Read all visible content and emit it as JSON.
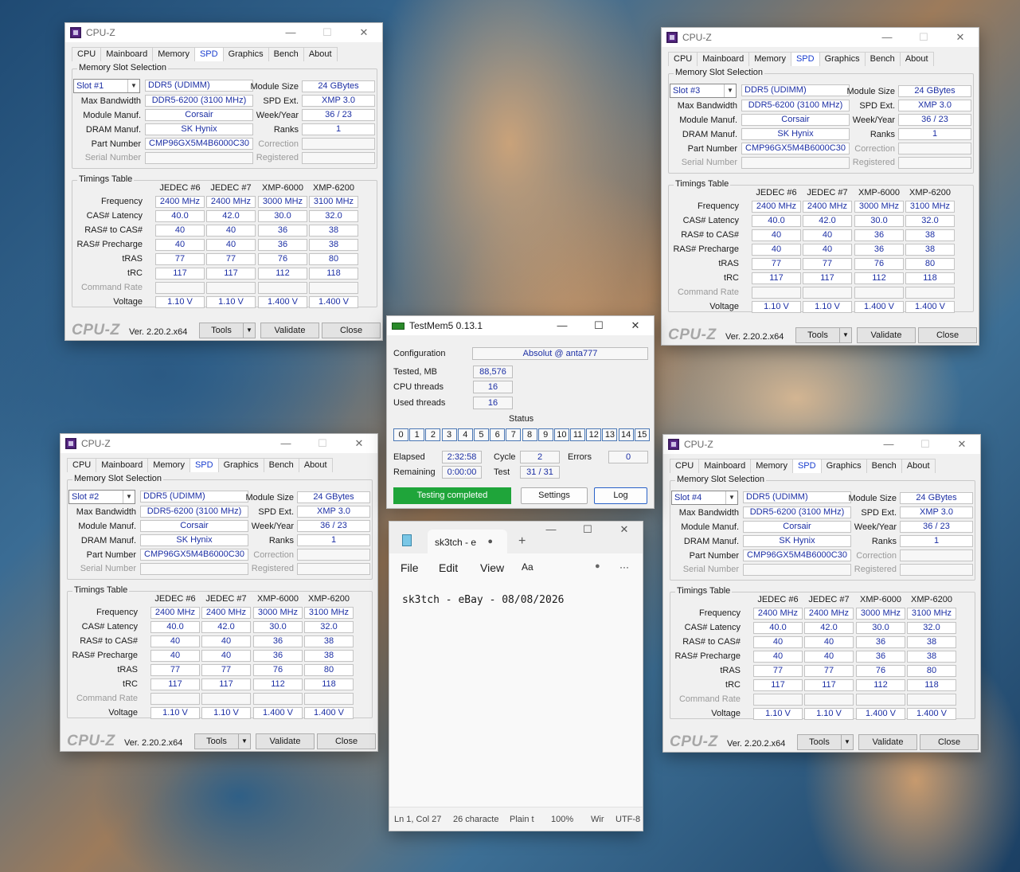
{
  "cpuz": {
    "title": "CPU-Z",
    "tabs": [
      "CPU",
      "Mainboard",
      "Memory",
      "SPD",
      "Graphics",
      "Bench",
      "About"
    ],
    "active_tab": "SPD",
    "min_icon": "—",
    "max_icon": "☐",
    "close_icon": "✕",
    "dropdown_icon": "▼",
    "group_memory": "Memory Slot Selection",
    "group_timings": "Timings Table",
    "labels": {
      "max_bandwidth": "Max Bandwidth",
      "module_manuf": "Module Manuf.",
      "dram_manuf": "DRAM Manuf.",
      "part_number": "Part Number",
      "serial_number": "Serial Number",
      "module_size": "Module Size",
      "spd_ext": "SPD Ext.",
      "week_year": "Week/Year",
      "ranks": "Ranks",
      "correction": "Correction",
      "registered": "Registered"
    },
    "values": {
      "type": "DDR5 (UDIMM)",
      "max_bandwidth": "DDR5-6200 (3100 MHz)",
      "module_manuf": "Corsair",
      "dram_manuf": "SK Hynix",
      "part_number": "CMP96GX5M4B6000C30",
      "module_size": "24 GBytes",
      "spd_ext": "XMP 3.0",
      "week_year": "36 / 23",
      "ranks": "1"
    },
    "timing_cols": [
      "JEDEC #6",
      "JEDEC #7",
      "XMP-6000",
      "XMP-6200"
    ],
    "timing_rows": [
      {
        "label": "Frequency",
        "vals": [
          "2400 MHz",
          "2400 MHz",
          "3000 MHz",
          "3100 MHz"
        ]
      },
      {
        "label": "CAS# Latency",
        "vals": [
          "40.0",
          "42.0",
          "30.0",
          "32.0"
        ]
      },
      {
        "label": "RAS# to CAS#",
        "vals": [
          "40",
          "40",
          "36",
          "38"
        ]
      },
      {
        "label": "RAS# Precharge",
        "vals": [
          "40",
          "40",
          "36",
          "38"
        ]
      },
      {
        "label": "tRAS",
        "vals": [
          "77",
          "77",
          "76",
          "80"
        ]
      },
      {
        "label": "tRC",
        "vals": [
          "117",
          "117",
          "112",
          "118"
        ]
      },
      {
        "label": "Command Rate",
        "vals": [
          "",
          "",
          "",
          ""
        ]
      },
      {
        "label": "Voltage",
        "vals": [
          "1.10 V",
          "1.10 V",
          "1.400 V",
          "1.400 V"
        ]
      }
    ],
    "brand": "CPU-Z",
    "version": "Ver. 2.20.2.x64",
    "btn_tools": "Tools",
    "btn_validate": "Validate",
    "btn_close": "Close",
    "windows": [
      {
        "slot": "Slot #1"
      },
      {
        "slot": "Slot #3"
      },
      {
        "slot": "Slot #2"
      },
      {
        "slot": "Slot #4"
      }
    ]
  },
  "testmem": {
    "title": "TestMem5  0.13.1",
    "configuration_label": "Configuration",
    "configuration": "Absolut @ anta777",
    "tested_label": "Tested, MB",
    "tested": "88,576",
    "cpu_threads_label": "CPU threads",
    "cpu_threads": "16",
    "used_threads_label": "Used threads",
    "used_threads": "16",
    "status_label": "Status",
    "cells": [
      "0",
      "1",
      "2",
      "3",
      "4",
      "5",
      "6",
      "7",
      "8",
      "9",
      "10",
      "11",
      "12",
      "13",
      "14",
      "15"
    ],
    "elapsed_label": "Elapsed",
    "elapsed": "2:32:58",
    "remaining_label": "Remaining",
    "remaining": "0:00:00",
    "cycle_label": "Cycle",
    "cycle": "2",
    "test_label": "Test",
    "test": "31 / 31",
    "errors_label": "Errors",
    "errors": "0",
    "status_text": "Testing completed",
    "btn_settings": "Settings",
    "btn_log": "Log",
    "status_color": "#1fa53a"
  },
  "notepad": {
    "tab_title": "sk3tch - e",
    "unsaved_dot": "●",
    "new_tab": "+",
    "menu": [
      "File",
      "Edit",
      "View"
    ],
    "heading_icon": "Aa",
    "profile_icon": "●",
    "more_icon": "···",
    "text": "sk3tch - eBay - 08/08/2026",
    "status": [
      "Ln 1, Col 27",
      "26 characte",
      "Plain t",
      "100%",
      "Wir",
      "UTF-8"
    ],
    "min_icon": "—",
    "max_icon": "☐",
    "close_icon": "✕"
  }
}
